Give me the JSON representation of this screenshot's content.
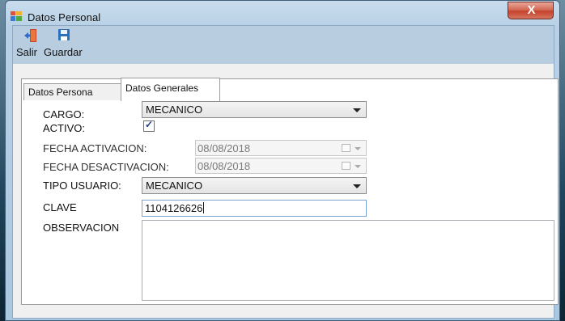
{
  "window": {
    "title": "Datos Personal",
    "close_label": "X",
    "icon": "form-window-icon"
  },
  "toolbar": {
    "items": [
      {
        "label": "Salir",
        "icon": "exit-door-icon"
      },
      {
        "label": "Guardar",
        "icon": "save-floppy-icon"
      }
    ]
  },
  "tabs": [
    {
      "label": "Datos Persona",
      "active": false
    },
    {
      "label": "Datos Generales",
      "active": true
    }
  ],
  "form": {
    "cargo": {
      "label": "CARGO:",
      "value": "MECANICO"
    },
    "activo": {
      "label": "ACTIVO:",
      "checked": true
    },
    "fecha_activacion": {
      "label": "FECHA ACTIVACION:",
      "value": "08/08/2018"
    },
    "fecha_desactivacion": {
      "label": "FECHA DESACTIVACION:",
      "value": "08/08/2018"
    },
    "tipo_usuario": {
      "label": "TIPO USUARIO:",
      "value": "MECANICO"
    },
    "clave": {
      "label": "CLAVE",
      "value": "1104126626"
    },
    "observacion": {
      "label": "OBSERVACION",
      "value": ""
    }
  },
  "colors": {
    "titlebar": "#b9d1e6",
    "toolbar": "#b8cde0",
    "close_button": "#c5422d",
    "save_icon": "#2d6fb8",
    "exit_icon": "#d9532e"
  }
}
